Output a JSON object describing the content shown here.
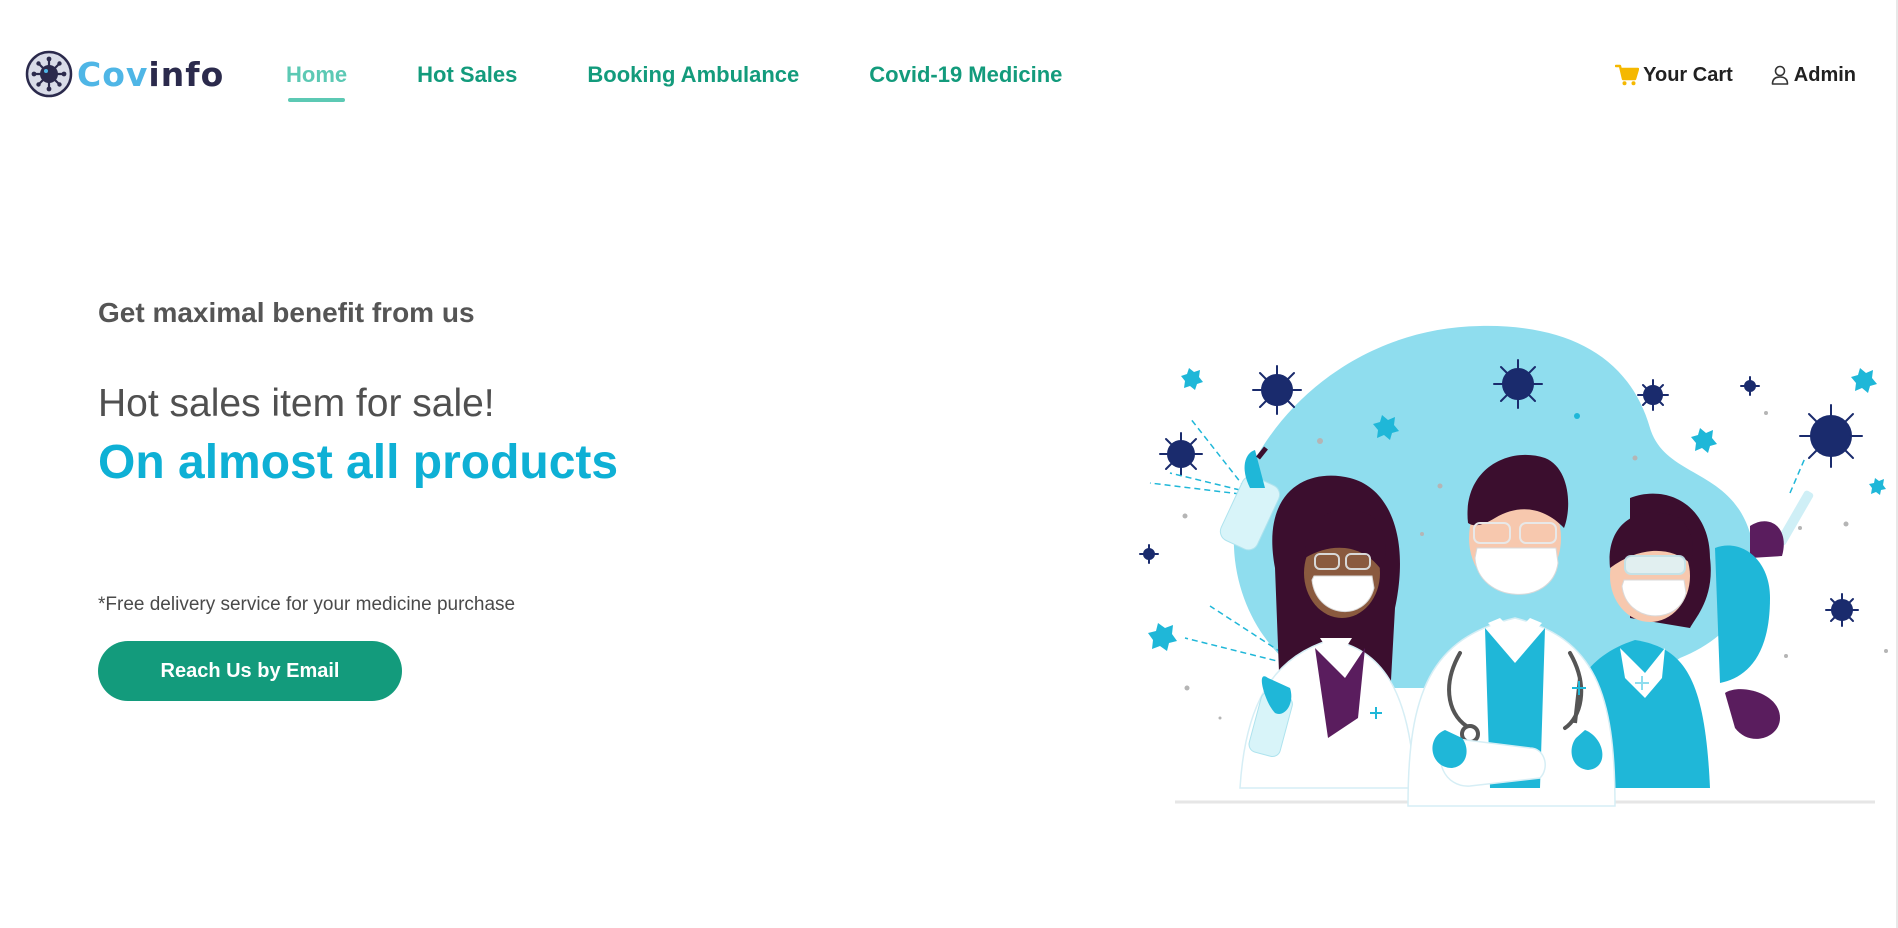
{
  "nav": {
    "logo": {
      "part1": "Cov",
      "part2": "info"
    },
    "links": [
      {
        "label": "Home",
        "active": true
      },
      {
        "label": "Hot Sales",
        "active": false
      },
      {
        "label": "Booking Ambulance",
        "active": false
      },
      {
        "label": "Covid-19 Medicine",
        "active": false
      }
    ],
    "cart_label": "Your Cart",
    "admin_label": "Admin"
  },
  "hero": {
    "eyebrow": "Get maximal benefit from us",
    "title": "Hot sales item for sale!",
    "subtitle": "On almost all products",
    "note": "*Free delivery service for your medicine purchase",
    "button_label": "Reach Us by Email"
  },
  "icons": {
    "logo": "virus-icon",
    "cart": "cart-icon",
    "admin": "user-icon"
  },
  "colors": {
    "brand_green": "#139b7c",
    "active_nav": "#5cc9b4",
    "accent_blue": "#0eb0d5",
    "logo_blue": "#4fb6e6",
    "logo_dark": "#2b2a4c",
    "cart_yellow": "#f5b800"
  }
}
